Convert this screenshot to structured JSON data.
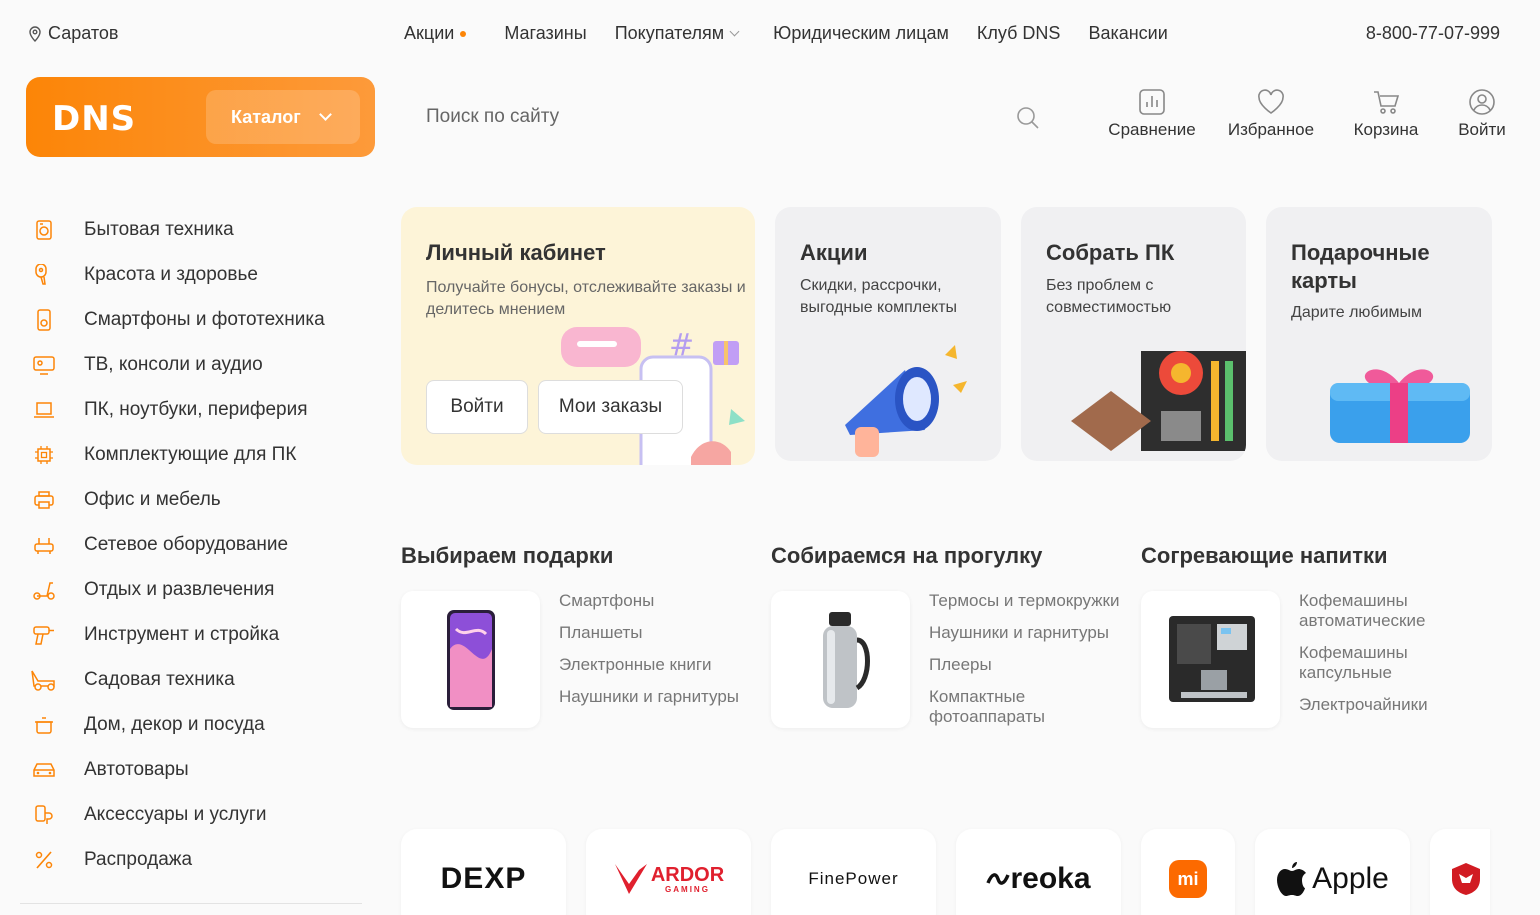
{
  "topbar": {
    "city": "Саратов",
    "nav": [
      {
        "label": "Акции",
        "dot": true
      },
      {
        "label": "Магазины"
      },
      {
        "label": "Покупателям",
        "chevron": true
      },
      {
        "label": "Юридическим лицам"
      },
      {
        "label": "Клуб DNS"
      },
      {
        "label": "Вакансии"
      }
    ],
    "phone": "8-800-77-07-999"
  },
  "header": {
    "logo": "DNS",
    "catalog_label": "Каталог",
    "search_placeholder": "Поиск по сайту",
    "actions": [
      {
        "label": "Сравнение",
        "icon": "compare-icon"
      },
      {
        "label": "Избранное",
        "icon": "heart-icon"
      },
      {
        "label": "Корзина",
        "icon": "cart-icon"
      },
      {
        "label": "Войти",
        "icon": "user-icon"
      }
    ]
  },
  "sidebar": {
    "items": [
      {
        "label": "Бытовая техника",
        "icon": "washer-icon"
      },
      {
        "label": "Красота и здоровье",
        "icon": "hairdryer-icon"
      },
      {
        "label": "Смартфоны и фототехника",
        "icon": "smartphone-icon"
      },
      {
        "label": "ТВ, консоли и аудио",
        "icon": "tv-icon"
      },
      {
        "label": "ПК, ноутбуки, периферия",
        "icon": "laptop-icon"
      },
      {
        "label": "Комплектующие для ПК",
        "icon": "cpu-icon"
      },
      {
        "label": "Офис и мебель",
        "icon": "printer-icon"
      },
      {
        "label": "Сетевое оборудование",
        "icon": "router-icon"
      },
      {
        "label": "Отдых и развлечения",
        "icon": "scooter-icon"
      },
      {
        "label": "Инструмент и стройка",
        "icon": "drill-icon"
      },
      {
        "label": "Садовая техника",
        "icon": "lawnmower-icon"
      },
      {
        "label": "Дом, декор и посуда",
        "icon": "pot-icon"
      },
      {
        "label": "Автотовары",
        "icon": "car-icon"
      },
      {
        "label": "Аксессуары и услуги",
        "icon": "accessories-icon"
      },
      {
        "label": "Распродажа",
        "icon": "percent-icon"
      }
    ]
  },
  "promos": {
    "account": {
      "title": "Личный кабинет",
      "text": "Получайте бонусы, отслеживайте заказы и делитесь мнением",
      "login_label": "Войти",
      "orders_label": "Мои заказы"
    },
    "sales": {
      "title": "Акции",
      "text": "Скидки, рассрочки, выгодные комплекты"
    },
    "build_pc": {
      "title": "Собрать ПК",
      "text": "Без проблем с совместимостью"
    },
    "gift_cards": {
      "title": "Подарочные карты",
      "text": "Дарите любимым"
    }
  },
  "collections": [
    {
      "title": "Выбираем подарки",
      "image": "smartphone-image",
      "links": [
        "Смартфоны",
        "Планшеты",
        "Электронные книги",
        "Наушники и гарнитуры"
      ]
    },
    {
      "title": "Собираемся на прогулку",
      "image": "thermos-image",
      "links": [
        "Термосы и термокружки",
        "Наушники и гарнитуры",
        "Плееры",
        "Компактные фотоаппараты"
      ]
    },
    {
      "title": "Согревающие напитки",
      "image": "coffee-machine-image",
      "links": [
        "Кофемашины автоматические",
        "Кофемашины капсульные",
        "Электрочайники"
      ]
    }
  ],
  "brands": [
    {
      "name": "DEXP"
    },
    {
      "name": "ARDOR",
      "sub": "GAMING"
    },
    {
      "name": "FinePower"
    },
    {
      "name": "reoka"
    },
    {
      "name": "mi"
    },
    {
      "name": "Apple"
    },
    {
      "name": "msi"
    }
  ],
  "colors": {
    "accent": "#fc8507",
    "account_bg": "#fdf4d8",
    "card_bg": "#f0f0f2"
  }
}
